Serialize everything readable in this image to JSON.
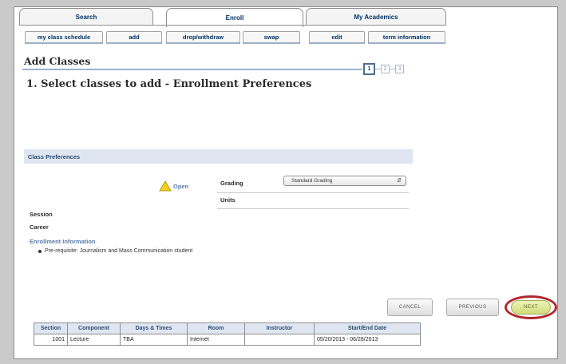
{
  "main_tabs": [
    {
      "label": "Search"
    },
    {
      "label": "Enroll"
    },
    {
      "label": "My Academics"
    }
  ],
  "sub_tabs": [
    {
      "label": "my class schedule"
    },
    {
      "label": "add"
    },
    {
      "label": "drop/withdraw"
    },
    {
      "label": "swap"
    },
    {
      "label": "edit"
    },
    {
      "label": "term information"
    }
  ],
  "page_title": "Add Classes",
  "steps": [
    "1",
    "2",
    "3"
  ],
  "subheading": "1.  Select classes to add - Enrollment Preferences",
  "preferences": {
    "section_title": "Class Preferences",
    "status": "Open",
    "grading_label": "Grading",
    "grading_value": "Standard Grading",
    "units_label": "Units",
    "session_label": "Session",
    "career_label": "Career",
    "info_heading": "Enrollment Information",
    "info_items": [
      "Pre-requisite: Journalism and Mass Communication student"
    ]
  },
  "buttons": {
    "cancel": "CANCEL",
    "previous": "PREVIOUS",
    "next": "NEXT"
  },
  "table": {
    "headers": [
      "Section",
      "Component",
      "Days & Times",
      "Room",
      "Instructor",
      "Start/End Date"
    ],
    "rows": [
      [
        "1001",
        "Lecture",
        "TBA",
        "Internet",
        "",
        "05/20/2013 - 06/28/2013"
      ]
    ]
  },
  "colors": {
    "accent": "#2b4a70",
    "section_bar": "#dfe6f1",
    "next_highlight": "#b2272b",
    "warning": "#f2d21a"
  }
}
